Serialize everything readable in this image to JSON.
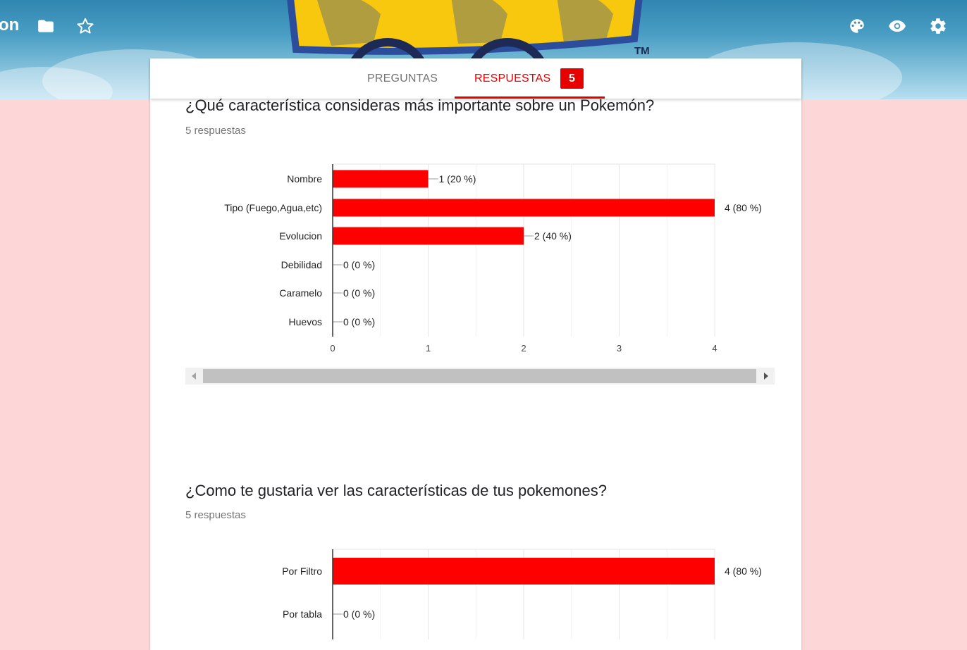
{
  "header": {
    "title_fragment": "on",
    "icons": [
      "folder-icon",
      "star-icon",
      "palette-icon",
      "eye-icon",
      "gear-icon"
    ],
    "logo_mark": "TM"
  },
  "tabs": {
    "questions_label": "PREGUNTAS",
    "responses_label": "RESPUESTAS",
    "responses_count": "5"
  },
  "colors": {
    "accent": "#e60000",
    "background": "#fdd6d7",
    "bar": "#ff0000"
  },
  "questions": [
    {
      "title": "¿Qué característica consideras más importante sobre un Pokemón?",
      "subtitle": "5 respuestas"
    },
    {
      "title": "¿Como te gustaria ver las características de tus pokemones?",
      "subtitle": "5 respuestas"
    }
  ],
  "chart_data": [
    {
      "type": "bar",
      "orientation": "horizontal",
      "categories": [
        "Nombre",
        "Tipo (Fuego,Agua,etc)",
        "Evolucion",
        "Debilidad",
        "Caramelo",
        "Huevos"
      ],
      "values": [
        1,
        4,
        2,
        0,
        0,
        0
      ],
      "labels": [
        "1 (20 %)",
        "4 (80 %)",
        "2 (40 %)",
        "0 (0 %)",
        "0 (0 %)",
        "0 (0 %)"
      ],
      "xticks": [
        "0",
        "1",
        "2",
        "3",
        "4"
      ],
      "xlim": [
        0,
        4
      ]
    },
    {
      "type": "bar",
      "orientation": "horizontal",
      "categories": [
        "Por Filtro",
        "Por tabla"
      ],
      "values": [
        4,
        0
      ],
      "labels": [
        "4 (80 %)",
        "0 (0 %)"
      ],
      "xlim": [
        0,
        4
      ]
    }
  ]
}
